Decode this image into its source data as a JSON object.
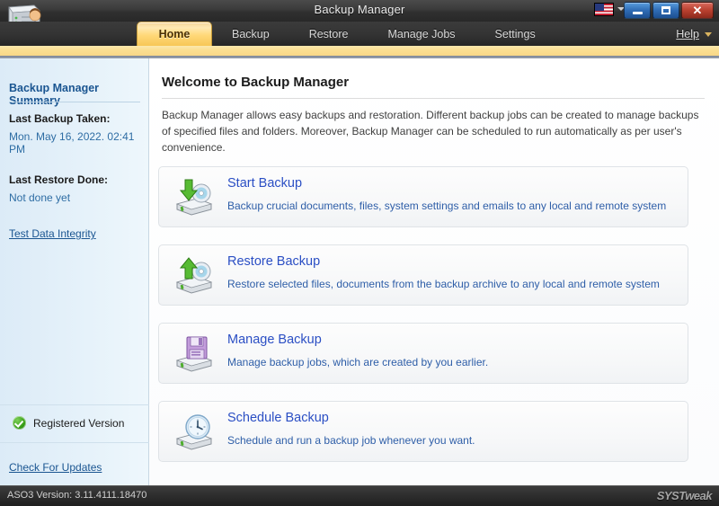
{
  "window": {
    "title": "Backup Manager",
    "logo_icon": "backup-manager-logo-icon",
    "language_flag": "us-flag-icon",
    "minimize_label": "",
    "maximize_label": "",
    "close_label": "✕"
  },
  "tabs": [
    {
      "label": "Home",
      "active": true
    },
    {
      "label": "Backup",
      "active": false
    },
    {
      "label": "Restore",
      "active": false
    },
    {
      "label": "Manage Jobs",
      "active": false
    },
    {
      "label": "Settings",
      "active": false
    }
  ],
  "help_menu": {
    "label": "Help",
    "accel_letter": "H",
    "caret_icon": "chevron-down-icon"
  },
  "sidebar": {
    "title": "Backup Manager Summary",
    "last_backup_label": "Last Backup Taken:",
    "last_backup_value": "Mon. May 16, 2022. 02:41 PM",
    "last_restore_label": "Last Restore Done:",
    "last_restore_value": "Not done yet",
    "test_data_integrity_link": "Test Data Integrity",
    "registered_label": "Registered Version",
    "registered_icon": "green-check-icon",
    "check_updates_link": "Check For Updates"
  },
  "main": {
    "heading": "Welcome to Backup Manager",
    "intro": "Backup Manager allows easy backups and restoration. Different backup jobs can be created to manage backups of specified files and folders. Moreover, Backup Manager can be scheduled to run automatically as per user's convenience.",
    "cards": [
      {
        "icon": "hard-drive-download-icon",
        "title": "Start Backup",
        "desc": "Backup crucial documents, files, system settings and emails to any local and remote system"
      },
      {
        "icon": "hard-drive-upload-icon",
        "title": "Restore Backup",
        "desc": "Restore selected files, documents from the backup archive to any local and remote system"
      },
      {
        "icon": "floppy-disk-icon",
        "title": "Manage Backup",
        "desc": "Manage backup jobs, which are created by you earlier."
      },
      {
        "icon": "clock-icon",
        "title": "Schedule Backup",
        "desc": "Schedule and run a backup job whenever you want."
      }
    ]
  },
  "statusbar": {
    "version_text": "ASO3 Version: 3.11.4111.18470",
    "watermark": "SYSTweak"
  },
  "colors": {
    "accent_gold": "#f8d887",
    "link_blue": "#2b4fc4",
    "sidebar_blue": "#e6f2fa",
    "titlebar_dark": "#303030",
    "registered_green": "#39a018"
  }
}
